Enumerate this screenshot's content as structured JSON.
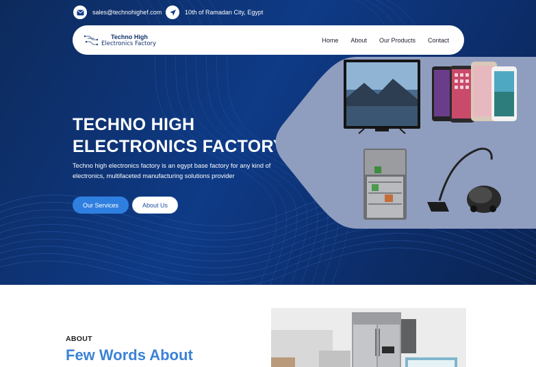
{
  "contact": {
    "email": "sales@technohighef.com",
    "address": "10th of Ramadan City, Egypt"
  },
  "brand": {
    "line1": "Techno High",
    "line2": "Electronics Factory"
  },
  "nav": [
    {
      "label": "Home"
    },
    {
      "label": "About"
    },
    {
      "label": "Our Products"
    },
    {
      "label": "Contact"
    }
  ],
  "hero": {
    "title_line1": "TECHNO HIGH",
    "title_line2": "ELECTRONICS FACTORY",
    "description": "Techno high electronics factory is an egypt base factory for any kind of electronics, multifaceted manufacturing solutions provider",
    "primary_button": "Our Services",
    "secondary_button": "About Us"
  },
  "about": {
    "tag": "ABOUT",
    "heading": "Few Words About"
  },
  "colors": {
    "hero_bg": "#0e3a86",
    "accent": "#2f7fe0",
    "heading_blue": "#3b82d6",
    "panel": "#8d9bbd"
  },
  "icons": [
    "envelope-icon",
    "navigation-arrow-icon"
  ]
}
